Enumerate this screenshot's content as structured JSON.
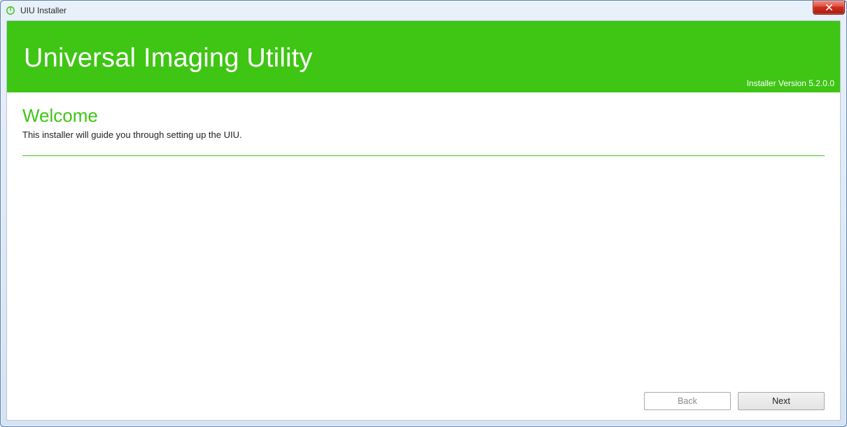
{
  "window": {
    "title": "UIU Installer"
  },
  "banner": {
    "product_title": "Universal Imaging Utility",
    "version_label": "Installer Version 5.2.0.0"
  },
  "page": {
    "heading": "Welcome",
    "description": "This installer will guide you through setting up the UIU."
  },
  "footer": {
    "back_label": "Back",
    "next_label": "Next"
  },
  "colors": {
    "accent": "#3fc514"
  }
}
